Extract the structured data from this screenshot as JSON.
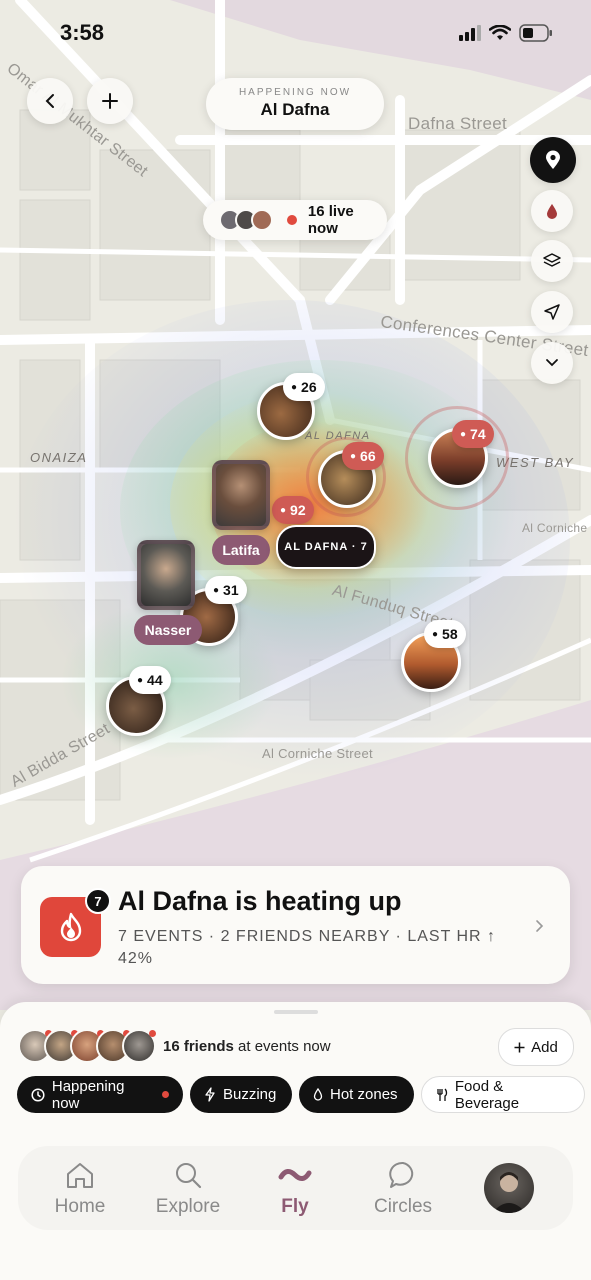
{
  "status_bar": {
    "time": "3:58"
  },
  "header": {
    "eyebrow": "HAPPENING NOW",
    "title": "Al Dafna"
  },
  "live": {
    "label": "16 live now"
  },
  "map": {
    "streets": [
      "Omar Al Mukhtar Street",
      "Dafna Street",
      "Conferences Center Street",
      "Al Funduq Street",
      "Al Bidda Street",
      "Al Corniche Street",
      "Al Corniche"
    ],
    "districts": [
      "ONAIZA",
      "AL DAFNA",
      "WEST BAY"
    ]
  },
  "markers": [
    {
      "count": "26"
    },
    {
      "count": "66"
    },
    {
      "count": "74"
    },
    {
      "count": "92"
    },
    {
      "count": "31"
    },
    {
      "count": "58"
    },
    {
      "count": "44"
    }
  ],
  "friends_on_map": [
    "Latifa",
    "Nasser"
  ],
  "zone_label": "AL DAFNA · 7",
  "heat_card": {
    "badge": "7",
    "title": "Al Dafna is heating up",
    "subtitle": "7 EVENTS · 2 FRIENDS NEARBY · LAST HR ↑ 42%"
  },
  "friends_bar": {
    "count_bold": "16 friends",
    "rest": " at events now",
    "add_label": "Add"
  },
  "chips": [
    "Happening now",
    "Buzzing",
    "Hot zones",
    "Food & Beverage"
  ],
  "tabs": [
    "Home",
    "Explore",
    "Fly",
    "Circles"
  ],
  "colors": {
    "accent": "#8d5a73",
    "hot": "#cf5b55",
    "flame": "#e0473b"
  }
}
